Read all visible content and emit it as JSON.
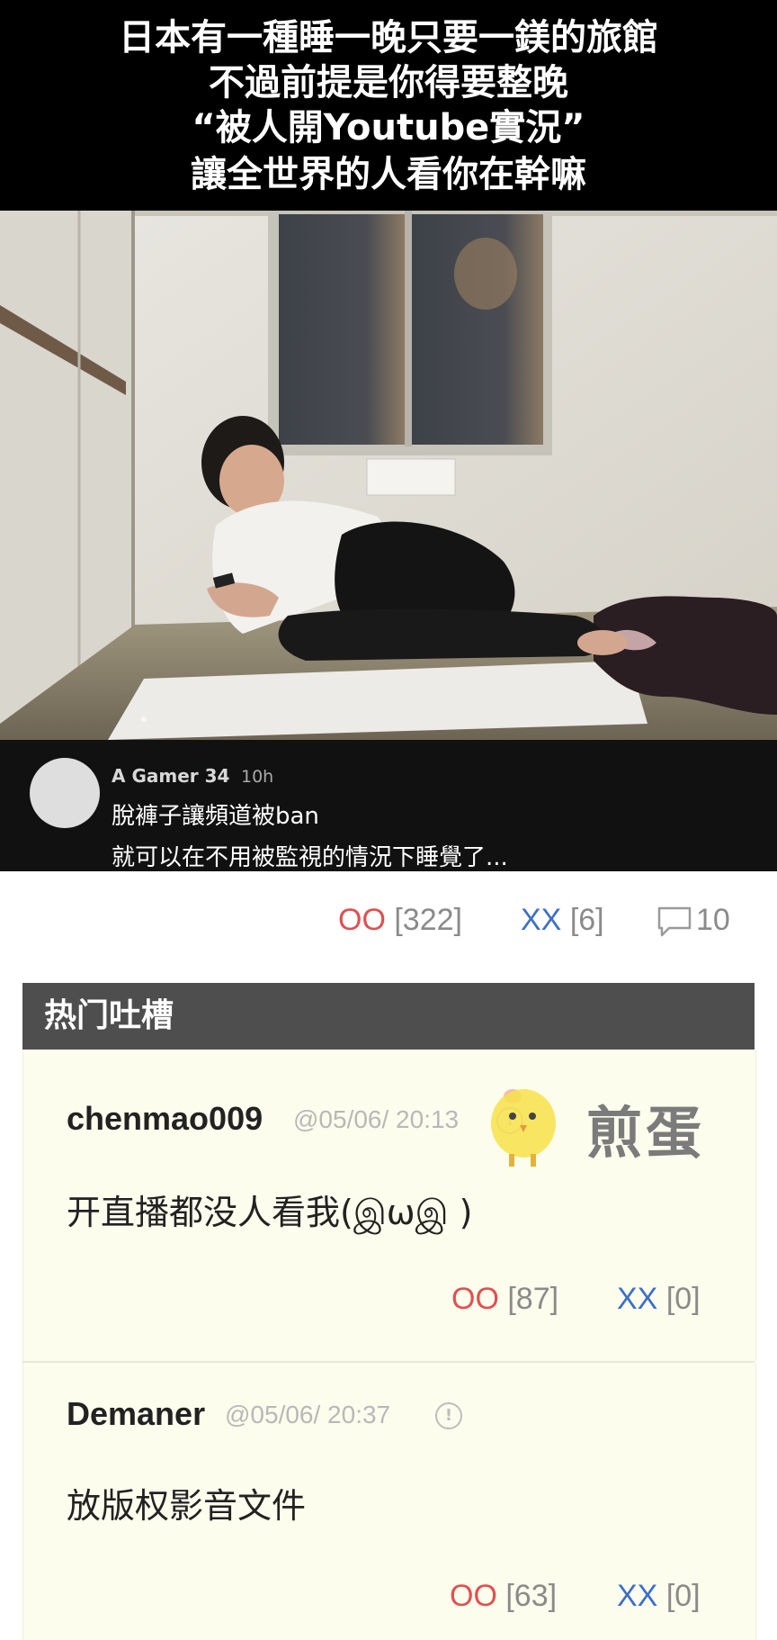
{
  "post_image": {
    "caption_lines": [
      "日本有一種睡一晚只要一鎂的旅館",
      "不過前提是你得要整晚",
      "“被人開Youtube實況”",
      "讓全世界的人看你在幹嘛"
    ],
    "overlay_comment": {
      "username": "A Gamer 34",
      "time": "10h",
      "lines": [
        "脫褲子讓頻道被ban",
        "就可以在不用被監視的情況下睡覺了..."
      ]
    }
  },
  "post_votes": {
    "oo_label": "OO",
    "oo_count": "[322]",
    "xx_label": "XX",
    "xx_count": "[6]",
    "comment_count": "10",
    "comment_icon": "speech-bubble-icon"
  },
  "hot_comments": {
    "title": "热门吐槽",
    "items": [
      {
        "author": "chenmao009",
        "time": "@05/06/ 20:13",
        "text": "开直播都没人看我(இωஇ )",
        "oo_label": "OO",
        "oo_count": "[87]",
        "xx_label": "XX",
        "xx_count": "[0]"
      },
      {
        "author": "Demaner",
        "time": "@05/06/ 20:37",
        "text": "放版权影音文件",
        "oo_label": "OO",
        "oo_count": "[63]",
        "xx_label": "XX",
        "xx_count": "[0]"
      }
    ]
  },
  "watermark": {
    "text": "煎蛋",
    "icon": "chick-icon"
  },
  "colors": {
    "oo": "#e05050",
    "xx": "#3c6fc9",
    "header_bg": "#4e4e4e",
    "card_bg": "#fdfdee"
  }
}
